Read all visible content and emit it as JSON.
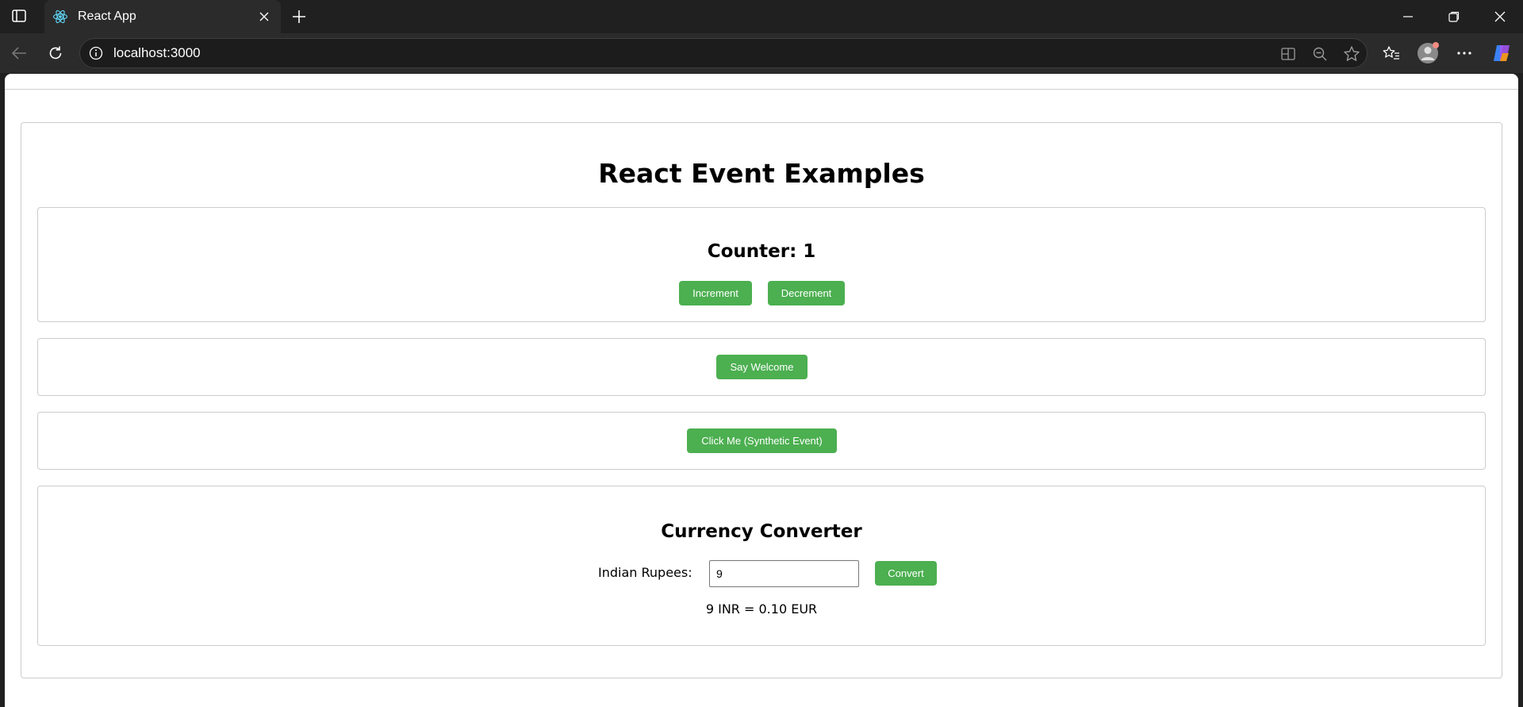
{
  "browser": {
    "tab_title": "React App",
    "url": "localhost:3000"
  },
  "app": {
    "title": "React Event Examples",
    "counter": {
      "heading": "Counter: 1",
      "increment_label": "Increment",
      "decrement_label": "Decrement"
    },
    "welcome": {
      "button_label": "Say Welcome"
    },
    "synthetic": {
      "button_label": "Click Me (Synthetic Event)"
    },
    "converter": {
      "heading": "Currency Converter",
      "input_label": "Indian Rupees:",
      "input_value": "9",
      "convert_label": "Convert",
      "result": "9 INR = 0.10 EUR"
    }
  },
  "colors": {
    "button_green": "#4caf50",
    "browser_dark": "#202020"
  }
}
